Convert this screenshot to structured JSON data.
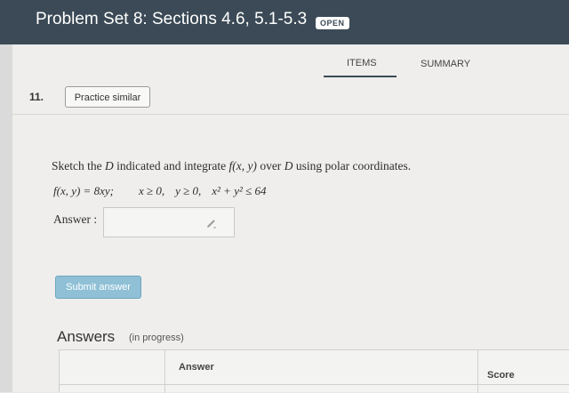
{
  "header": {
    "title": "Problem Set 8: Sections 4.6, 5.1-5.3",
    "badge": "OPEN"
  },
  "tabs": [
    {
      "label": "ITEMS",
      "active": true
    },
    {
      "label": "SUMMARY",
      "active": false
    }
  ],
  "question": {
    "number": "11.",
    "practice_label": "Practice similar",
    "prompt": {
      "t1": "Sketch the ",
      "D1": "D",
      "t2": " indicated and integrate ",
      "f": "f(x, y)",
      "t3": " over ",
      "D2": "D",
      "t4": " using polar coordinates."
    },
    "formula": {
      "fdef": "f(x, y) = 8xy;",
      "c1": "x ≥ 0,",
      "c2": "y ≥ 0,",
      "c3": "x² + y² ≤ 64"
    },
    "answer_label": "Answer :",
    "answer_value": "",
    "submit_label": "Submit answer"
  },
  "answers": {
    "heading": "Answers",
    "status": "(in progress)",
    "columns": [
      "Answer",
      "Score"
    ]
  },
  "colors": {
    "header_bg": "#3b4a56",
    "submit_bg": "#8fc0d6"
  },
  "icons": {
    "answer_edit": "pencil-icon"
  }
}
